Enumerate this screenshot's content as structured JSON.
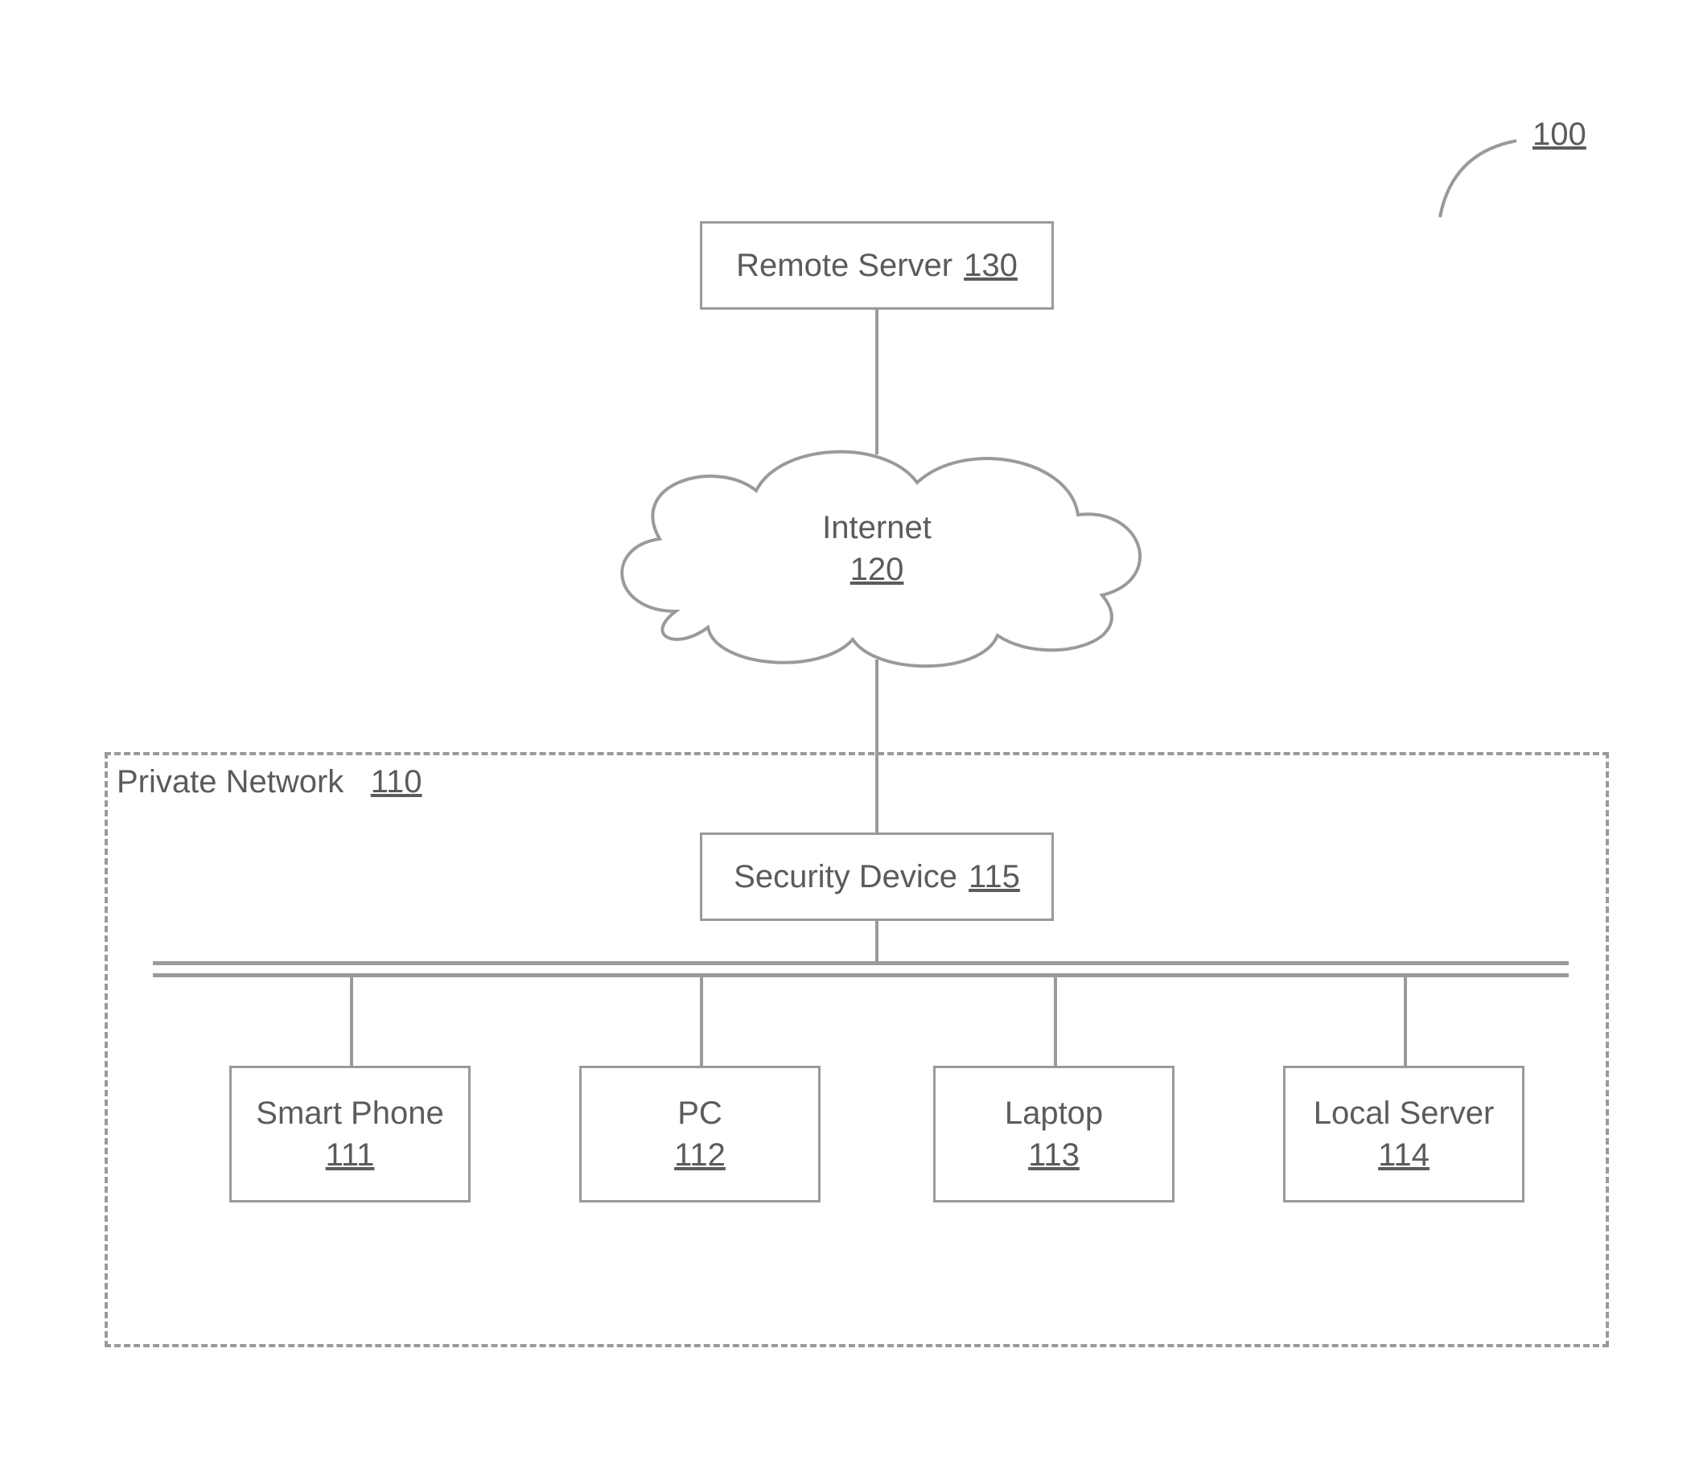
{
  "figure": {
    "number": "100"
  },
  "remote_server": {
    "label": "Remote Server",
    "num": "130"
  },
  "internet": {
    "label": "Internet",
    "num": "120"
  },
  "private_network": {
    "label": "Private Network",
    "num": "110"
  },
  "security_device": {
    "label": "Security Device",
    "num": "115"
  },
  "devices": {
    "smart_phone": {
      "label": "Smart Phone",
      "num": "111"
    },
    "pc": {
      "label": "PC",
      "num": "112"
    },
    "laptop": {
      "label": "Laptop",
      "num": "113"
    },
    "local_server": {
      "label": "Local Server",
      "num": "114"
    }
  }
}
